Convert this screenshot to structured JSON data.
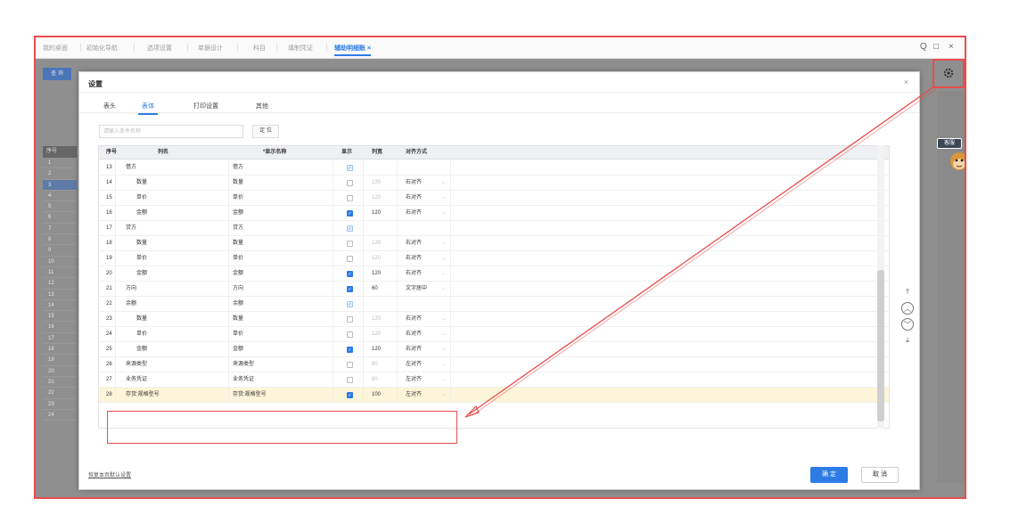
{
  "top_tabs": [
    "我的桌面",
    "初始化导航",
    "选项设置",
    "单据设计",
    "科目",
    "填制凭证",
    "辅助明细账"
  ],
  "window_controls": [
    "Q",
    "□",
    "×"
  ],
  "background": {
    "button_label": "查 询",
    "row_header": "序号",
    "row_numbers": [
      "1",
      "2",
      "3",
      "4",
      "5",
      "6",
      "7",
      "8",
      "9",
      "10",
      "11",
      "12",
      "13",
      "14",
      "15",
      "16",
      "17",
      "18",
      "19",
      "20",
      "21",
      "22",
      "23",
      "24"
    ],
    "side_badge": "客服"
  },
  "dialog": {
    "title": "设置",
    "close": "×",
    "tabs": [
      "表头",
      "表体",
      "打印设置",
      "其他"
    ],
    "active_tab": 1,
    "search_placeholder": "请输入条件名称",
    "search_button": "定 位",
    "columns": [
      "序号",
      "列名",
      "*显示名称",
      "显示",
      "列宽",
      "对齐方式"
    ],
    "rows": [
      {
        "no": "13",
        "name": "借方",
        "display": "借方",
        "check": "dis",
        "width": "",
        "align": "",
        "indent": false
      },
      {
        "no": "14",
        "name": "数量",
        "display": "数量",
        "check": "off",
        "width": "120",
        "align": "右对齐",
        "indent": true
      },
      {
        "no": "15",
        "name": "单价",
        "display": "单价",
        "check": "off",
        "width": "120",
        "align": "右对齐",
        "indent": true
      },
      {
        "no": "16",
        "name": "金额",
        "display": "金额",
        "check": "on",
        "width": "120",
        "align": "右对齐",
        "indent": true
      },
      {
        "no": "17",
        "name": "贷方",
        "display": "贷方",
        "check": "dis",
        "width": "",
        "align": "",
        "indent": false
      },
      {
        "no": "18",
        "name": "数量",
        "display": "数量",
        "check": "off",
        "width": "120",
        "align": "右对齐",
        "indent": true
      },
      {
        "no": "19",
        "name": "单价",
        "display": "单价",
        "check": "off",
        "width": "120",
        "align": "右对齐",
        "indent": true
      },
      {
        "no": "20",
        "name": "金额",
        "display": "金额",
        "check": "on",
        "width": "120",
        "align": "右对齐",
        "indent": true
      },
      {
        "no": "21",
        "name": "方向",
        "display": "方向",
        "check": "on",
        "width": "60",
        "align": "文字居中",
        "indent": false
      },
      {
        "no": "22",
        "name": "余额",
        "display": "余额",
        "check": "dis",
        "width": "",
        "align": "",
        "indent": false
      },
      {
        "no": "23",
        "name": "数量",
        "display": "数量",
        "check": "off",
        "width": "120",
        "align": "右对齐",
        "indent": true
      },
      {
        "no": "24",
        "name": "单价",
        "display": "单价",
        "check": "off",
        "width": "120",
        "align": "右对齐",
        "indent": true
      },
      {
        "no": "25",
        "name": "金额",
        "display": "金额",
        "check": "on",
        "width": "120",
        "align": "右对齐",
        "indent": true
      },
      {
        "no": "26",
        "name": "来源类型",
        "display": "来源类型",
        "check": "off",
        "width": "80",
        "align": "左对齐",
        "indent": false
      },
      {
        "no": "27",
        "name": "业务凭证",
        "display": "业务凭证",
        "check": "off",
        "width": "80",
        "align": "左对齐",
        "indent": false
      },
      {
        "no": "28",
        "name": "存货:规格型号",
        "display": "存货:规格型号",
        "check": "on",
        "width": "100",
        "align": "左对齐",
        "indent": false
      }
    ],
    "reset_link": "恢复本页默认设置",
    "ok_button": "确 定",
    "cancel_button": "取 消"
  },
  "nav_icons": [
    "top-icon",
    "up-icon",
    "down-icon",
    "bottom-icon"
  ],
  "colors": {
    "accent": "#2d7be5",
    "annotation": "#e84c4c",
    "selected_row": "#fdf5d9"
  }
}
